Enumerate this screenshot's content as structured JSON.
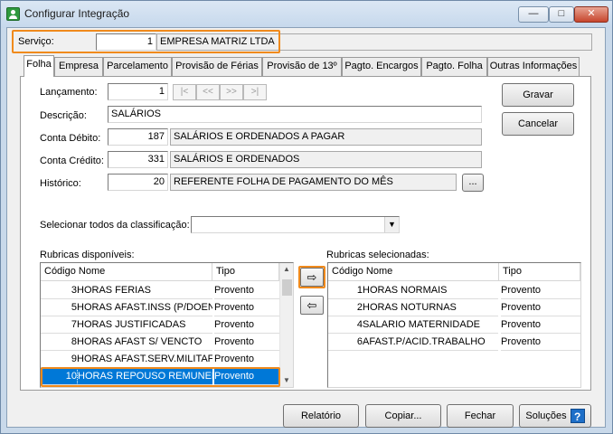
{
  "window": {
    "title": "Configurar Integração",
    "minimize": "—",
    "maximize": "□",
    "close": "✕"
  },
  "servico": {
    "label": "Serviço:",
    "code": "1",
    "name": "EMPRESA MATRIZ LTDA"
  },
  "tabs": [
    {
      "label": "Folha"
    },
    {
      "label": "Empresa"
    },
    {
      "label": "Parcelamento"
    },
    {
      "label": "Provisão de Férias"
    },
    {
      "label": "Provisão de 13º"
    },
    {
      "label": "Pagto. Encargos"
    },
    {
      "label": "Pagto. Folha"
    },
    {
      "label": "Outras Informações"
    }
  ],
  "form": {
    "lancamento_label": "Lançamento:",
    "lancamento_value": "1",
    "nav": [
      "|<",
      "<<",
      ">>",
      ">|"
    ],
    "descricao_label": "Descrição:",
    "descricao_value": "SALÁRIOS",
    "conta_debito_label": "Conta Débito:",
    "conta_debito_code": "187",
    "conta_debito_name": "SALÁRIOS E ORDENADOS A PAGAR",
    "conta_credito_label": "Conta Crédito:",
    "conta_credito_code": "331",
    "conta_credito_name": "SALÁRIOS E ORDENADOS",
    "historico_label": "Histórico:",
    "historico_code": "20",
    "historico_text": "REFERENTE FOLHA DE PAGAMENTO DO MÊS",
    "historico_browse": "...",
    "gravar": "Gravar",
    "cancelar": "Cancelar",
    "classificacao_label": "Selecionar todos da classificação:",
    "classificacao_value": ""
  },
  "available": {
    "label": "Rubricas disponíveis:",
    "columns": [
      "Código",
      "Nome",
      "Tipo"
    ],
    "rows": [
      {
        "code": "3",
        "name": "HORAS FERIAS",
        "type": "Provento"
      },
      {
        "code": "5",
        "name": "HORAS AFAST.INSS (P/DOEN",
        "type": "Provento"
      },
      {
        "code": "7",
        "name": "HORAS JUSTIFICADAS",
        "type": "Provento"
      },
      {
        "code": "8",
        "name": "HORAS AFAST S/ VENCTO",
        "type": "Provento"
      },
      {
        "code": "9",
        "name": "HORAS AFAST.SERV.MILITAF",
        "type": "Provento"
      },
      {
        "code": "10",
        "name": "HORAS REPOUSO REMUNEF",
        "type": "Provento"
      }
    ]
  },
  "selected": {
    "label": "Rubricas selecionadas:",
    "columns": [
      "Código",
      "Nome",
      "Tipo"
    ],
    "rows": [
      {
        "code": "1",
        "name": "HORAS NORMAIS",
        "type": "Provento"
      },
      {
        "code": "2",
        "name": "HORAS NOTURNAS",
        "type": "Provento"
      },
      {
        "code": "4",
        "name": "SALARIO MATERNIDADE",
        "type": "Provento"
      },
      {
        "code": "6",
        "name": "AFAST.P/ACID.TRABALHO",
        "type": "Provento"
      }
    ]
  },
  "transfer": {
    "add": "⇨",
    "remove": "⇦"
  },
  "footer": {
    "relatorio": "Relatório",
    "copiar": "Copiar...",
    "fechar": "Fechar",
    "solucoes": "Soluções",
    "help": "?"
  },
  "colors": {
    "highlight": "#f08a1c",
    "selection": "#0078d7"
  }
}
